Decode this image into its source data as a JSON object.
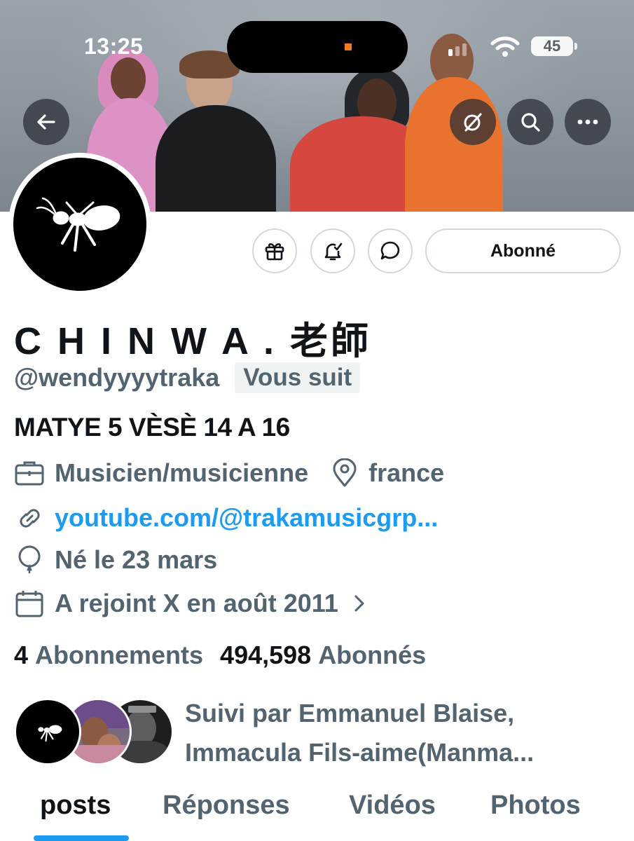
{
  "status_bar": {
    "time": "13:25",
    "battery": "45"
  },
  "profile": {
    "name": "C H I N W A . 老師",
    "handle": "@wendyyyytraka",
    "follows_you": "Vous suit",
    "bio": "MATYE 5 VÈSÈ 14 A 16",
    "category": "Musicien/musicienne",
    "location": "france",
    "website": "youtube.com/@trakamusicgrp...",
    "birthday": "Né le 23 mars",
    "joined": "A rejoint X en août 2011",
    "following_count": "4",
    "following_label": "Abonnements",
    "followers_count": "494,598",
    "followers_label": "Abonnés",
    "followed_by_line1": "Suivi par Emmanuel Blaise,",
    "followed_by_line2": "Immacula Fils-aime(Manma..."
  },
  "actions": {
    "follow_label": "Abonné"
  },
  "tabs": [
    {
      "label": "posts",
      "active": true
    },
    {
      "label": "Réponses",
      "active": false
    },
    {
      "label": "Vidéos",
      "active": false
    },
    {
      "label": "Photos",
      "active": false
    }
  ],
  "colors": {
    "accent": "#1d9bf0",
    "secondary_text": "#536471",
    "primary_text": "#0f1419",
    "border": "#cfd9de"
  },
  "icons": [
    "back-arrow-icon",
    "grok-icon",
    "search-icon",
    "more-icon",
    "gift-icon",
    "notification-bell-icon",
    "message-icon",
    "briefcase-icon",
    "location-pin-icon",
    "link-icon",
    "balloon-icon",
    "calendar-icon",
    "chevron-right-icon"
  ]
}
